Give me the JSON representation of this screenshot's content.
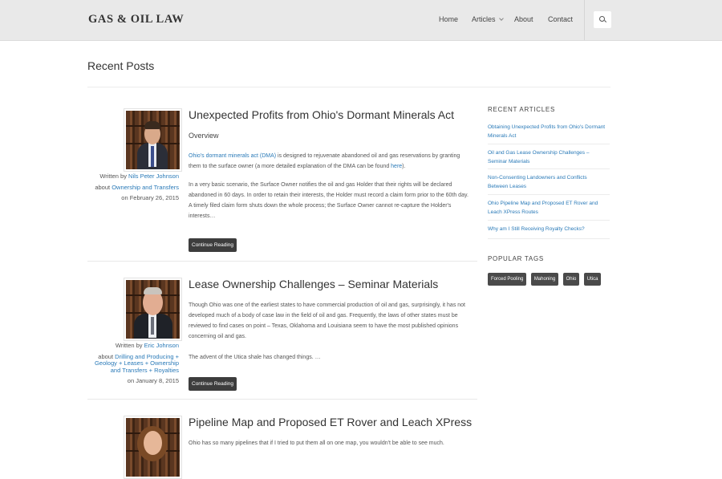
{
  "header": {
    "logo": "GAS & OIL LAW",
    "nav": [
      "Home",
      "Articles",
      "About",
      "Contact"
    ],
    "search_icon": "search-icon"
  },
  "page_title": "Recent Posts",
  "posts": [
    {
      "title": "Unexpected Profits from Ohio's Dormant Minerals Act",
      "subtitle": "Overview",
      "written_by": "Written by",
      "author": "Nils Peter Johnson",
      "about": "about",
      "category": "Ownership and Transfers",
      "date": "on February 26, 2015",
      "para1_link": "Ohio's dormant minerals act (DMA)",
      "para1_text": " is designed to rejuvenate abandoned oil and gas reservations by granting them to the surface owner (a more detailed explanation of the DMA can be found ",
      "para1_link2": "here",
      "para1_end": ").",
      "para2": "In a very basic scenario, the Surface Owner notifies the oil and gas Holder that their rights will be declared abandoned in 60 days.  In order to retain their interests, the Holder must record a claim form prior to the 60th day.  A timely filed claim form shuts down the whole process; the Surface Owner cannot re-capture the Holder's interests…",
      "button": "Continue Reading"
    },
    {
      "title": "Lease Ownership Challenges – Seminar Materials",
      "written_by": "Written by",
      "author": "Eric Johnson",
      "about": "about",
      "category": "Drilling and Producing + Geology + Leases + Ownership and Transfers + Royalties",
      "date": "on January 8, 2015",
      "para1": "Though Ohio was one of the earliest states to have commercial production of oil and gas, surprisingly, it has not developed much of a body of case law in the field of oil and gas.  Frequently, the laws of other states must be reviewed to find cases on point – Texas, Oklahoma and Louisiana seem to have the most published opinions concerning oil and gas.",
      "para2": "The advent of the Utica shale has changed things. …",
      "button": "Continue Reading"
    },
    {
      "title": "Pipeline Map and Proposed ET Rover and Leach XPress",
      "para1": "Ohio has so many pipelines that if I tried to put them all on one map, you wouldn't be able to see much."
    }
  ],
  "sidebar": {
    "recent_heading": "RECENT ARTICLES",
    "recent": [
      "Obtaining Unexpected Profits from Ohio's Dormant Minerals Act",
      "Oil and Gas Lease Ownership Challenges – Seminar Materials",
      "Non-Consenting Landowners and Conflicts Between Leases",
      "Ohio Pipeline Map and Proposed ET Rover and Leach XPress Routes",
      "Why am I Still Receiving Royalty Checks?"
    ],
    "tags_heading": "POPULAR TAGS",
    "tags": [
      "Forced Pooling",
      "Mahoning",
      "Ohio",
      "Utica"
    ]
  }
}
